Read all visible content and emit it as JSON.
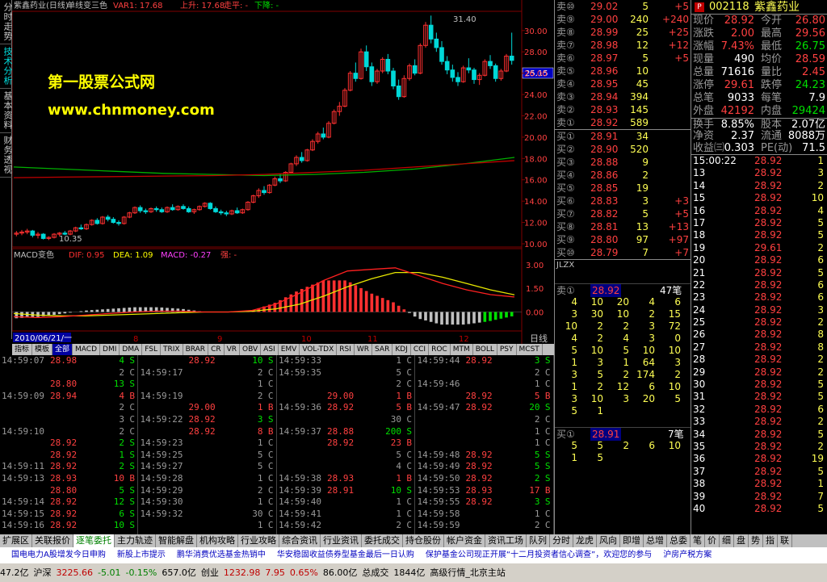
{
  "left_tabs": [
    {
      "label": "分时走势",
      "active": false
    },
    {
      "label": "技术分析",
      "active": true
    },
    {
      "label": "基本资料",
      "active": false
    },
    {
      "label": "财务透视",
      "active": false
    }
  ],
  "chart": {
    "title": "紫鑫药业(日线)",
    "indicator": "单线变三色",
    "var1": "VAR1: 17.68",
    "up_line": "上升: 17.68",
    "flat": "走平: -",
    "down": "下降: -",
    "watermark_line1": "第一股票公式网",
    "watermark_line2": "www.chnmoney.com",
    "high_label": "31.40",
    "low_label": "10.35",
    "current_price_box": "25.15",
    "price_axis": [
      "30.00",
      "28.00",
      "26.00",
      "24.00",
      "22.00",
      "20.00",
      "18.00",
      "16.00",
      "14.00",
      "12.00",
      "10.00"
    ],
    "macd_title": "MACD变色",
    "dif": "DIF: 0.95",
    "dea": "DEA: 1.09",
    "macd_val": "MACD: -0.27",
    "strong": "强: -",
    "macd_axis": [
      "3.00",
      "1.50",
      "0.00"
    ],
    "date_label": "2010/06/21/一",
    "month_ticks": [
      "8",
      "9",
      "10",
      "11",
      "12"
    ],
    "period_label": "日线",
    "colors": {
      "up": "#ff3030",
      "down": "#00d8d8",
      "ma60": "#00b000",
      "ma120": "#c00000",
      "dif": "#ff2020",
      "dea": "#e8e800"
    }
  },
  "chart_data": {
    "type": "candlestick",
    "candles": [
      [
        10.9,
        11.2,
        10.7,
        11.0
      ],
      [
        11.0,
        11.3,
        10.8,
        11.1
      ],
      [
        11.1,
        11.4,
        10.9,
        11.2
      ],
      [
        11.2,
        11.3,
        10.6,
        10.8
      ],
      [
        10.8,
        11.1,
        10.5,
        10.9
      ],
      [
        10.9,
        11.0,
        10.4,
        10.5
      ],
      [
        10.5,
        10.7,
        10.35,
        10.6
      ],
      [
        10.6,
        11.0,
        10.5,
        10.9
      ],
      [
        10.9,
        11.1,
        10.7,
        11.0
      ],
      [
        11.0,
        11.2,
        10.8,
        10.9
      ],
      [
        10.9,
        11.3,
        10.8,
        11.2
      ],
      [
        11.2,
        11.6,
        11.1,
        11.5
      ],
      [
        11.5,
        11.8,
        11.3,
        11.4
      ],
      [
        11.4,
        11.9,
        11.3,
        11.8
      ],
      [
        11.8,
        12.3,
        11.7,
        12.2
      ],
      [
        12.2,
        12.4,
        11.8,
        11.9
      ],
      [
        11.9,
        12.6,
        11.8,
        12.5
      ],
      [
        12.5,
        12.7,
        12.1,
        12.3
      ],
      [
        12.3,
        12.5,
        11.9,
        12.0
      ],
      [
        12.0,
        12.2,
        11.7,
        11.9
      ],
      [
        11.9,
        12.6,
        11.8,
        12.5
      ],
      [
        12.5,
        13.0,
        12.4,
        12.9
      ],
      [
        12.9,
        13.5,
        12.8,
        13.4
      ],
      [
        13.4,
        13.6,
        12.9,
        13.1
      ],
      [
        13.1,
        13.3,
        12.8,
        13.0
      ],
      [
        13.0,
        13.4,
        12.9,
        13.3
      ],
      [
        13.3,
        13.5,
        13.0,
        13.2
      ],
      [
        13.2,
        13.4,
        12.9,
        13.0
      ],
      [
        13.0,
        13.5,
        12.9,
        13.4
      ],
      [
        13.4,
        13.7,
        13.1,
        13.2
      ],
      [
        13.2,
        13.6,
        13.1,
        13.5
      ],
      [
        13.5,
        13.7,
        13.2,
        13.3
      ],
      [
        13.3,
        13.5,
        12.9,
        13.0
      ],
      [
        13.0,
        13.3,
        12.8,
        13.2
      ],
      [
        13.2,
        13.6,
        13.1,
        13.5
      ],
      [
        13.5,
        13.9,
        13.4,
        13.8
      ],
      [
        13.8,
        13.9,
        13.2,
        13.3
      ],
      [
        13.3,
        13.5,
        12.9,
        13.0
      ],
      [
        13.0,
        13.2,
        12.7,
        12.9
      ],
      [
        12.9,
        13.1,
        12.6,
        12.8
      ],
      [
        12.8,
        13.2,
        12.7,
        13.1
      ],
      [
        13.1,
        13.4,
        12.8,
        12.9
      ],
      [
        12.9,
        13.3,
        12.8,
        13.2
      ],
      [
        13.2,
        14.0,
        13.1,
        13.9
      ],
      [
        13.9,
        14.6,
        13.8,
        14.5
      ],
      [
        14.5,
        15.2,
        14.3,
        15.0
      ],
      [
        15.0,
        15.4,
        14.6,
        14.8
      ],
      [
        14.8,
        15.6,
        14.7,
        15.5
      ],
      [
        15.5,
        16.3,
        15.4,
        16.1
      ],
      [
        16.1,
        16.6,
        15.7,
        15.9
      ],
      [
        15.9,
        16.8,
        15.8,
        16.7
      ],
      [
        16.7,
        17.6,
        16.6,
        17.5
      ],
      [
        17.5,
        18.3,
        17.3,
        18.1
      ],
      [
        18.1,
        18.6,
        17.6,
        17.8
      ],
      [
        17.8,
        18.9,
        17.7,
        18.8
      ],
      [
        18.8,
        19.8,
        18.7,
        19.6
      ],
      [
        19.6,
        20.5,
        19.4,
        20.3
      ],
      [
        20.3,
        20.9,
        19.8,
        20.0
      ],
      [
        20.0,
        21.5,
        19.9,
        21.3
      ],
      [
        21.3,
        22.6,
        21.2,
        22.4
      ],
      [
        22.4,
        23.3,
        22.0,
        22.9
      ],
      [
        22.9,
        24.6,
        22.8,
        24.4
      ],
      [
        24.4,
        26.2,
        24.3,
        26.0
      ],
      [
        26.0,
        27.0,
        25.2,
        25.5
      ],
      [
        25.5,
        28.3,
        25.4,
        28.0
      ],
      [
        28.0,
        28.6,
        26.2,
        26.6
      ],
      [
        26.6,
        27.0,
        24.8,
        25.2
      ],
      [
        25.2,
        26.4,
        25.0,
        26.2
      ],
      [
        26.2,
        27.5,
        26.0,
        27.3
      ],
      [
        27.3,
        27.8,
        25.9,
        26.2
      ],
      [
        26.2,
        26.5,
        24.5,
        24.8
      ],
      [
        24.8,
        25.4,
        23.5,
        23.8
      ],
      [
        23.8,
        25.8,
        23.7,
        25.5
      ],
      [
        25.5,
        26.9,
        25.3,
        26.7
      ],
      [
        26.7,
        27.3,
        25.8,
        26.0
      ],
      [
        26.0,
        28.8,
        25.9,
        28.6
      ],
      [
        28.6,
        30.8,
        28.4,
        30.5
      ],
      [
        30.5,
        31.4,
        28.8,
        29.2
      ],
      [
        29.2,
        29.8,
        28.0,
        28.4
      ],
      [
        28.4,
        29.0,
        26.8,
        27.1
      ],
      [
        27.1,
        27.6,
        25.9,
        26.3
      ],
      [
        26.3,
        26.8,
        25.2,
        25.6
      ],
      [
        25.6,
        26.1,
        24.8,
        25.2
      ],
      [
        25.2,
        26.7,
        25.1,
        26.5
      ],
      [
        26.5,
        27.4,
        26.0,
        26.3
      ],
      [
        26.3,
        26.5,
        25.0,
        25.4
      ],
      [
        25.4,
        26.0,
        24.9,
        25.8
      ],
      [
        25.8,
        27.3,
        25.7,
        27.1
      ],
      [
        27.1,
        27.7,
        26.4,
        26.7
      ],
      [
        26.7,
        26.9,
        25.2,
        25.5
      ],
      [
        25.5,
        26.4,
        25.3,
        26.2
      ],
      [
        26.2,
        27.8,
        26.1,
        27.6
      ],
      [
        27.6,
        29.8,
        26.8,
        27.2
      ]
    ],
    "ma_green": [
      17.2,
      17.0,
      16.8,
      16.6,
      16.5,
      16.4,
      16.5,
      16.7,
      17.0,
      17.5,
      18.1
    ],
    "ma_red": [
      16.2,
      16.25,
      16.3,
      16.35,
      16.4,
      16.5,
      16.7,
      16.9,
      17.2,
      17.5,
      17.8
    ],
    "dif": [
      -0.3,
      -0.35,
      -0.3,
      -0.2,
      -0.1,
      0.0,
      0.05,
      0.05,
      0.0,
      0.0,
      0.1,
      0.5,
      1.2,
      2.0,
      2.6,
      2.7,
      2.8,
      2.3,
      1.8,
      1.4,
      1.1,
      0.95
    ],
    "dea": [
      -0.1,
      -0.2,
      -0.25,
      -0.25,
      -0.2,
      -0.15,
      -0.1,
      -0.05,
      0.0,
      0.0,
      0.05,
      0.2,
      0.5,
      1.0,
      1.6,
      2.1,
      2.5,
      2.5,
      2.2,
      1.8,
      1.4,
      1.09
    ],
    "ylim": [
      10.0,
      31.5
    ],
    "macd_ylim": [
      -1.0,
      3.3
    ]
  },
  "tech_tabs": [
    "指标",
    "模板",
    "全部",
    "MACD",
    "DMI",
    "DMA",
    "FSL",
    "TRIX",
    "BRAR",
    "CR",
    "VR",
    "OBV",
    "ASI",
    "EMV",
    "VOL-TDX",
    "RSI",
    "WR",
    "SAR",
    "KDJ",
    "CCI",
    "ROC",
    "MTM",
    "BOLL",
    "PSY",
    "MCST"
  ],
  "tech_tab_active": 2,
  "ticks": [
    [
      [
        "14:59:07",
        "28.98",
        "4",
        "S"
      ],
      [
        "",
        "",
        "2",
        "C"
      ],
      [
        "",
        "28.80",
        "13",
        "S"
      ],
      [
        "14:59:09",
        "28.94",
        "4",
        "B"
      ],
      [
        "",
        "",
        "2",
        "C"
      ],
      [
        "",
        "",
        "3",
        "C"
      ],
      [
        "14:59:10",
        "",
        "2",
        "C"
      ],
      [
        "",
        "28.92",
        "2",
        "S"
      ],
      [
        "",
        "28.92",
        "1",
        "S"
      ],
      [
        "14:59:11",
        "28.92",
        "2",
        "S"
      ],
      [
        "14:59:13",
        "28.93",
        "10",
        "B"
      ],
      [
        "",
        "28.80",
        "5",
        "S"
      ],
      [
        "14:59:14",
        "28.92",
        "12",
        "S"
      ],
      [
        "14:59:15",
        "28.92",
        "6",
        "S"
      ],
      [
        "14:59:16",
        "28.92",
        "10",
        "S"
      ]
    ],
    [
      [
        "",
        "28.92",
        "10",
        "S"
      ],
      [
        "14:59:17",
        "",
        "2",
        "C"
      ],
      [
        "",
        "",
        "1",
        "C"
      ],
      [
        "14:59:19",
        "",
        "2",
        "C"
      ],
      [
        "",
        "29.00",
        "1",
        "B"
      ],
      [
        "14:59:22",
        "28.92",
        "3",
        "S"
      ],
      [
        "",
        "28.92",
        "8",
        "B"
      ],
      [
        "14:59:23",
        "",
        "1",
        "C"
      ],
      [
        "14:59:25",
        "",
        "5",
        "C"
      ],
      [
        "14:59:27",
        "",
        "5",
        "C"
      ],
      [
        "14:59:28",
        "",
        "1",
        "C"
      ],
      [
        "14:59:29",
        "",
        "2",
        "C"
      ],
      [
        "14:59:30",
        "",
        "1",
        "C"
      ],
      [
        "14:59:32",
        "",
        "30",
        "C"
      ],
      [
        "",
        "",
        "1",
        "C"
      ]
    ],
    [
      [
        "14:59:33",
        "",
        "1",
        "C"
      ],
      [
        "14:59:35",
        "",
        "5",
        "C"
      ],
      [
        "",
        "",
        "2",
        "C"
      ],
      [
        "",
        "29.00",
        "1",
        "B"
      ],
      [
        "14:59:36",
        "28.92",
        "5",
        "B"
      ],
      [
        "",
        "",
        "30",
        "C"
      ],
      [
        "14:59:37",
        "28.88",
        "200",
        "S"
      ],
      [
        "",
        "28.92",
        "23",
        "B"
      ],
      [
        "",
        "",
        "5",
        "C"
      ],
      [
        "",
        "",
        "4",
        "C"
      ],
      [
        "14:59:38",
        "28.93",
        "1",
        "B"
      ],
      [
        "14:59:39",
        "28.91",
        "10",
        "S"
      ],
      [
        "14:59:40",
        "",
        "1",
        "C"
      ],
      [
        "14:59:41",
        "",
        "1",
        "C"
      ],
      [
        "14:59:42",
        "",
        "2",
        "C"
      ]
    ],
    [
      [
        "14:59:44",
        "28.92",
        "3",
        "S"
      ],
      [
        "",
        "",
        "2",
        "C"
      ],
      [
        "14:59:46",
        "",
        "1",
        "C"
      ],
      [
        "",
        "28.92",
        "5",
        "B"
      ],
      [
        "14:59:47",
        "28.92",
        "20",
        "S"
      ],
      [
        "",
        "",
        "2",
        "C"
      ],
      [
        "",
        "",
        "1",
        "C"
      ],
      [
        "",
        "",
        "1",
        "C"
      ],
      [
        "14:59:48",
        "28.92",
        "5",
        "S"
      ],
      [
        "14:59:49",
        "28.92",
        "5",
        "S"
      ],
      [
        "14:59:50",
        "28.92",
        "2",
        "S"
      ],
      [
        "14:59:53",
        "28.93",
        "17",
        "B"
      ],
      [
        "14:59:55",
        "28.92",
        "3",
        "S"
      ],
      [
        "14:59:58",
        "",
        "1",
        "C"
      ],
      [
        "14:59:59",
        "",
        "2",
        "C"
      ]
    ]
  ],
  "order_book": {
    "sells": [
      [
        "卖⑩",
        "29.02",
        "5",
        "+5"
      ],
      [
        "卖⑨",
        "29.00",
        "240",
        "+240"
      ],
      [
        "卖⑧",
        "28.99",
        "25",
        "+25"
      ],
      [
        "卖⑦",
        "28.98",
        "12",
        "+12"
      ],
      [
        "卖⑥",
        "28.97",
        "5",
        "+5"
      ],
      [
        "卖⑤",
        "28.96",
        "10",
        ""
      ],
      [
        "卖④",
        "28.95",
        "45",
        ""
      ],
      [
        "卖③",
        "28.94",
        "394",
        ""
      ],
      [
        "卖②",
        "28.93",
        "145",
        ""
      ],
      [
        "卖①",
        "28.92",
        "589",
        ""
      ]
    ],
    "buys": [
      [
        "买①",
        "28.91",
        "34",
        ""
      ],
      [
        "买②",
        "28.90",
        "520",
        ""
      ],
      [
        "买③",
        "28.88",
        "9",
        ""
      ],
      [
        "买④",
        "28.86",
        "2",
        ""
      ],
      [
        "买⑤",
        "28.85",
        "19",
        ""
      ],
      [
        "买⑥",
        "28.83",
        "3",
        "+3"
      ],
      [
        "买⑦",
        "28.82",
        "5",
        "+5"
      ],
      [
        "买⑧",
        "28.81",
        "13",
        "+13"
      ],
      [
        "买⑨",
        "28.80",
        "97",
        "+97"
      ],
      [
        "买⑩",
        "28.79",
        "7",
        "+7"
      ]
    ],
    "jlzx": "JLZX",
    "queue_sell_label": "卖①",
    "queue_sell_price": "28.92",
    "queue_sell_count": "47笔",
    "queue_sell": [
      [
        "4",
        "10",
        "20",
        "4",
        "6"
      ],
      [
        "3",
        "30",
        "10",
        "2",
        "15"
      ],
      [
        "10",
        "2",
        "2",
        "3",
        "72"
      ],
      [
        "4",
        "2",
        "4",
        "3",
        "0"
      ],
      [
        "5",
        "10",
        "5",
        "10",
        "10"
      ],
      [
        "1",
        "3",
        "1",
        "64",
        "3"
      ],
      [
        "3",
        "5",
        "2",
        "174",
        "2"
      ],
      [
        "1",
        "2",
        "12",
        "6",
        "10"
      ],
      [
        "3",
        "10",
        "3",
        "20",
        "5"
      ],
      [
        "5",
        "1",
        "",
        "",
        ""
      ]
    ],
    "queue_buy_label": "买①",
    "queue_buy_price": "28.91",
    "queue_buy_count": "7笔",
    "queue_buy": [
      [
        "5",
        "5",
        "2",
        "6",
        "10"
      ],
      [
        "1",
        "5",
        "",
        "",
        ""
      ]
    ]
  },
  "quote": {
    "code": "002118",
    "name": "紫鑫药业",
    "rows": [
      [
        "现价",
        "28.92",
        "今开",
        "26.80"
      ],
      [
        "涨跌",
        "2.00",
        "最高",
        "29.56"
      ],
      [
        "涨幅",
        "7.43%",
        "最低",
        "26.75"
      ],
      [
        "现量",
        "490",
        "均价",
        "28.59"
      ],
      [
        "总量",
        "71616",
        "量比",
        "2.45"
      ],
      [
        "涨停",
        "29.61",
        "跌停",
        "24.23"
      ],
      [
        "总笔",
        "9033",
        "每笔",
        "7.9"
      ],
      [
        "外盘",
        "42192",
        "内盘",
        "29424"
      ],
      [
        "换手",
        "8.85%",
        "股本",
        "2.07亿"
      ],
      [
        "净资",
        "2.37",
        "流通",
        "8088万"
      ],
      [
        "收益㈢",
        "0.303",
        "PE(动)",
        "71.5"
      ]
    ],
    "trades": [
      [
        "15:00:22",
        "28.92",
        "1"
      ],
      [
        "13",
        "28.92",
        "3"
      ],
      [
        "14",
        "28.92",
        "2"
      ],
      [
        "15",
        "28.92",
        "10"
      ],
      [
        "16",
        "28.92",
        "4"
      ],
      [
        "17",
        "28.92",
        "5"
      ],
      [
        "18",
        "28.92",
        "5"
      ],
      [
        "19",
        "29.61",
        "2"
      ],
      [
        "20",
        "28.92",
        "6"
      ],
      [
        "21",
        "28.92",
        "5"
      ],
      [
        "22",
        "28.92",
        "6"
      ],
      [
        "23",
        "28.92",
        "6"
      ],
      [
        "24",
        "28.92",
        "3"
      ],
      [
        "25",
        "28.92",
        "2"
      ],
      [
        "26",
        "28.92",
        "8"
      ],
      [
        "27",
        "28.92",
        "8"
      ],
      [
        "28",
        "28.92",
        "2"
      ],
      [
        "29",
        "28.92",
        "2"
      ],
      [
        "30",
        "28.92",
        "5"
      ],
      [
        "31",
        "28.92",
        "5"
      ],
      [
        "32",
        "28.92",
        "6"
      ],
      [
        "33",
        "28.92",
        "2"
      ],
      [
        "34",
        "28.92",
        "5"
      ],
      [
        "35",
        "28.92",
        "2"
      ],
      [
        "36",
        "28.92",
        "19"
      ],
      [
        "37",
        "28.92",
        "5"
      ],
      [
        "38",
        "28.92",
        "1"
      ],
      [
        "39",
        "28.92",
        "7"
      ],
      [
        "40",
        "28.92",
        "5"
      ]
    ]
  },
  "bottom_tabs": [
    "扩展区",
    "关联报价",
    "逐笔委托",
    "主力轨迹",
    "智能解盘",
    "机构攻略",
    "行业攻略",
    "综合资讯",
    "行业资讯",
    "委托成交",
    "持仓股份",
    "帐户资金",
    "资讯工场",
    "队列",
    "分时",
    "龙虎",
    "风向",
    "即增",
    "总增",
    "总委",
    "笔",
    "价",
    "细",
    "盘",
    "势",
    "指",
    "联"
  ],
  "bottom_tab_active": 2,
  "news": [
    "国电电力A股增发今日申购",
    "新股上市提示",
    "鹏华消费优选基金热销中",
    "华安稳固收益债券型基金最后一日认购",
    "保护基金公司现正开展“十二月投资者信心调查”，欢迎您的参与",
    "沪房产税方案"
  ],
  "status": [
    "47.2亿",
    "沪深",
    "3225.66",
    "-5.01",
    "-0.15%",
    "657.0亿",
    "创业",
    "1232.98",
    "7.95",
    "0.65%",
    "86.00亿",
    "总成交",
    "1844亿",
    "高级行情_北京主站"
  ]
}
